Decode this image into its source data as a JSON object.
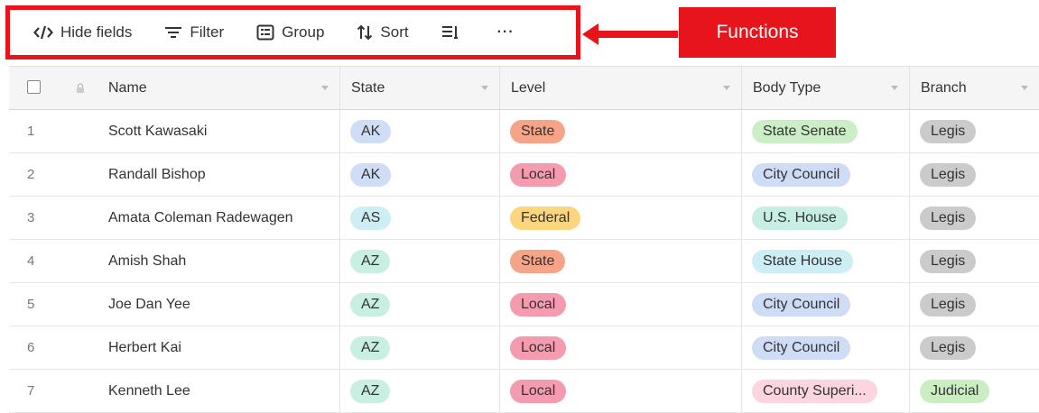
{
  "toolbar": {
    "hide_fields": "Hide fields",
    "filter": "Filter",
    "group": "Group",
    "sort": "Sort",
    "more": "···"
  },
  "callout": {
    "label": "Functions",
    "color": "#e8141b"
  },
  "columns": {
    "name": "Name",
    "state": "State",
    "level": "Level",
    "body_type": "Body Type",
    "branch": "Branch"
  },
  "pill_colors": {
    "state_ak": "#d0ddf7",
    "state_as": "#cdeff4",
    "state_az": "#c9efe3",
    "level_state": "#f5a487",
    "level_local": "#f49bb0",
    "level_federal": "#fbd67f",
    "body_state_senate": "#cbeec6",
    "body_city_council": "#cfdcf6",
    "body_us_house": "#c6eee3",
    "body_state_house": "#cdeef4",
    "body_county": "#fbd6e1",
    "branch_legis": "#cbcbcb",
    "branch_judicial": "#caedc1"
  },
  "rows": [
    {
      "num": "1",
      "name": "Scott Kawasaki",
      "state": "AK",
      "level": "State",
      "body": "State Senate",
      "branch": "Legis"
    },
    {
      "num": "2",
      "name": "Randall Bishop",
      "state": "AK",
      "level": "Local",
      "body": "City Council",
      "branch": "Legis"
    },
    {
      "num": "3",
      "name": "Amata Coleman Radewagen",
      "state": "AS",
      "level": "Federal",
      "body": "U.S. House",
      "branch": "Legis"
    },
    {
      "num": "4",
      "name": "Amish Shah",
      "state": "AZ",
      "level": "State",
      "body": "State House",
      "branch": "Legis"
    },
    {
      "num": "5",
      "name": "Joe Dan Yee",
      "state": "AZ",
      "level": "Local",
      "body": "City Council",
      "branch": "Legis"
    },
    {
      "num": "6",
      "name": "Herbert Kai",
      "state": "AZ",
      "level": "Local",
      "body": "City Council",
      "branch": "Legis"
    },
    {
      "num": "7",
      "name": "Kenneth Lee",
      "state": "AZ",
      "level": "Local",
      "body": "County Superi...",
      "branch": "Judicial"
    }
  ]
}
